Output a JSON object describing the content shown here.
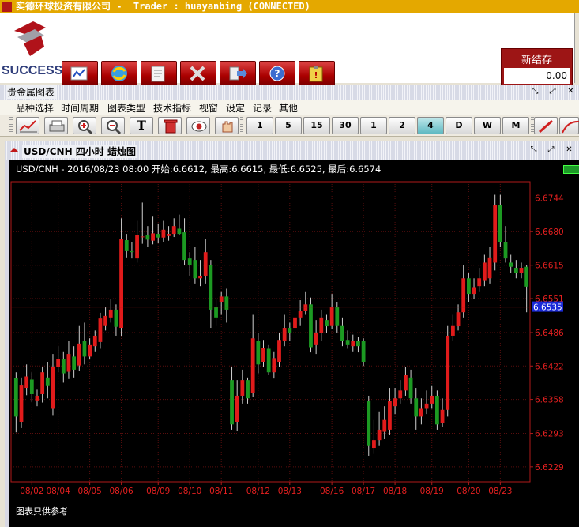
{
  "window": {
    "title": "实德环球投资有限公司 -  Trader : huayanbing (CONNECTED)"
  },
  "brand": {
    "logo_text": "SUCCESS"
  },
  "nav": {
    "buttons": [
      {
        "name": "chart-nav-button",
        "icon": "chart-icon"
      },
      {
        "name": "exchange-nav-button",
        "icon": "exchange-icon"
      },
      {
        "name": "orders-nav-button",
        "icon": "notepad-icon"
      },
      {
        "name": "tools-nav-button",
        "icon": "tools-icon"
      },
      {
        "name": "export-nav-button",
        "icon": "export-icon"
      },
      {
        "name": "help-nav-button",
        "icon": "help-icon"
      },
      {
        "name": "clipboard-nav-button",
        "icon": "clipboard-icon"
      }
    ]
  },
  "balance": {
    "label": "新结存",
    "value": "0.00"
  },
  "panel": {
    "title": "贵金属图表"
  },
  "menu": {
    "items": [
      "品种选择",
      "时间周期",
      "图表类型",
      "技术指标",
      "视窗",
      "设定",
      "记录",
      "其他"
    ]
  },
  "toolbar": {
    "period_buttons": [
      "1",
      "5",
      "15",
      "30",
      "1",
      "2",
      "4",
      "D",
      "W",
      "M"
    ]
  },
  "chart_window": {
    "title": "USD/CNH 四小时 蜡烛图",
    "info": "USD/CNH - 2016/08/23 08:00 开始:6.6612, 最高:6.6615, 最低:6.6525, 最后:6.6574",
    "footer": "图表只供参考",
    "current_price_label": "6.6535"
  },
  "chart_data": {
    "type": "candlestick",
    "symbol": "USD/CNH",
    "timeframe": "四小时",
    "y_ticks": [
      "6.6744",
      "6.6680",
      "6.6615",
      "6.6551",
      "6.6486",
      "6.6422",
      "6.6358",
      "6.6293",
      "6.6229"
    ],
    "x_ticks": [
      "08/02",
      "08/04",
      "08/05",
      "08/06",
      "08/09",
      "08/10",
      "08/11",
      "08/12",
      "08/13",
      "08/16",
      "08/17",
      "08/18",
      "08/19",
      "08/20",
      "08/23"
    ],
    "ylim": [
      6.62,
      6.6775
    ],
    "current_price": 6.6535,
    "colors": {
      "up": "#e11b1b",
      "down": "#1c9a22",
      "wick": "#d0d0d0",
      "grid": "#5a0e0e",
      "frame": "#b01a1a"
    },
    "candles": [
      [
        6.6399,
        6.6325,
        6.641,
        6.6295
      ],
      [
        6.6315,
        6.6386,
        6.64,
        6.6303
      ],
      [
        6.638,
        6.6402,
        6.6425,
        6.6366
      ],
      [
        6.6396,
        6.6368,
        6.641,
        6.6353
      ],
      [
        6.6356,
        6.6365,
        6.6378,
        6.6345
      ],
      [
        6.6368,
        6.641,
        6.642,
        6.6352
      ],
      [
        6.64,
        6.6385,
        6.643,
        6.636
      ],
      [
        6.634,
        6.642,
        6.6445,
        6.6328
      ],
      [
        6.642,
        6.6435,
        6.646,
        6.641
      ],
      [
        6.6435,
        6.6408,
        6.645,
        6.639
      ],
      [
        6.6411,
        6.6445,
        6.647,
        6.6397
      ],
      [
        6.644,
        6.6415,
        6.646,
        6.64
      ],
      [
        6.6423,
        6.6465,
        6.65,
        6.6412
      ],
      [
        6.647,
        6.644,
        6.6505,
        6.6425
      ],
      [
        6.644,
        6.6462,
        6.6475,
        6.6435
      ],
      [
        6.646,
        6.648,
        6.649,
        6.645
      ],
      [
        6.6468,
        6.6513,
        6.6524,
        6.6455
      ],
      [
        6.65,
        6.6518,
        6.6535,
        6.649
      ],
      [
        6.6515,
        6.653,
        6.655,
        6.6505
      ],
      [
        6.653,
        6.6497,
        6.654,
        6.648
      ],
      [
        6.6495,
        6.6665,
        6.6705,
        6.648
      ],
      [
        6.6663,
        6.6642,
        6.6675,
        6.663
      ],
      [
        6.6642,
        6.664,
        6.666,
        6.6628
      ],
      [
        6.6628,
        6.6673,
        6.67,
        6.662
      ],
      [
        6.667,
        6.667,
        6.6735,
        6.6656
      ],
      [
        6.6672,
        6.6664,
        6.669,
        6.665
      ],
      [
        6.6662,
        6.6676,
        6.6708,
        6.6655
      ],
      [
        6.6675,
        6.6668,
        6.6695,
        6.6658
      ],
      [
        6.6668,
        6.6683,
        6.67,
        6.666
      ],
      [
        6.6671,
        6.6675,
        6.669,
        6.6662
      ],
      [
        6.6675,
        6.669,
        6.6705,
        6.6669
      ],
      [
        6.6685,
        6.6675,
        6.6712,
        6.6672
      ],
      [
        6.6678,
        6.6625,
        6.6705,
        6.6615
      ],
      [
        6.6628,
        6.6615,
        6.664,
        6.6595
      ],
      [
        6.6625,
        6.659,
        6.665,
        6.658
      ],
      [
        6.659,
        6.6595,
        6.6625,
        6.6575
      ],
      [
        6.6595,
        6.664,
        6.6665,
        6.658
      ],
      [
        6.6615,
        6.653,
        6.6625,
        6.6495
      ],
      [
        6.6535,
        6.6515,
        6.655,
        6.65
      ],
      [
        6.6545,
        6.6555,
        6.6565,
        6.652
      ],
      [
        6.6555,
        6.653,
        6.657,
        6.6505
      ],
      [
        6.6395,
        6.631,
        6.642,
        6.63
      ],
      [
        6.6315,
        6.6365,
        6.6395,
        6.6298
      ],
      [
        6.6365,
        6.6395,
        6.6415,
        6.635
      ],
      [
        6.6395,
        6.636,
        6.64,
        6.635
      ],
      [
        6.637,
        6.6475,
        6.652,
        6.6362
      ],
      [
        6.647,
        6.6425,
        6.6485,
        6.6408
      ],
      [
        6.643,
        6.6457,
        6.6472,
        6.642
      ],
      [
        6.6455,
        6.641,
        6.6462,
        6.6405
      ],
      [
        6.641,
        6.6437,
        6.645,
        6.6398
      ],
      [
        6.643,
        6.6472,
        6.6485,
        6.642
      ],
      [
        6.647,
        6.6495,
        6.652,
        6.646
      ],
      [
        6.6495,
        6.6485,
        6.6505,
        6.647
      ],
      [
        6.6495,
        6.6515,
        6.6545,
        6.6482
      ],
      [
        6.6515,
        6.6528,
        6.6548,
        6.65
      ],
      [
        6.6527,
        6.654,
        6.6565,
        6.652
      ],
      [
        6.654,
        6.6458,
        6.6553,
        6.6448
      ],
      [
        6.6462,
        6.6485,
        6.651,
        6.6445
      ],
      [
        6.6485,
        6.6515,
        6.653,
        6.647
      ],
      [
        6.651,
        6.6498,
        6.652,
        6.6485
      ],
      [
        6.65,
        6.6535,
        6.656,
        6.6492
      ],
      [
        6.6535,
        6.65,
        6.6545,
        6.6485
      ],
      [
        6.65,
        6.647,
        6.6515,
        6.646
      ],
      [
        6.6472,
        6.6462,
        6.649,
        6.6455
      ],
      [
        6.646,
        6.647,
        6.6482,
        6.645
      ],
      [
        6.647,
        6.646,
        6.6478,
        6.6448
      ],
      [
        6.647,
        6.643,
        6.6475,
        6.6422
      ],
      [
        6.6355,
        6.627,
        6.6365,
        6.625
      ],
      [
        6.6265,
        6.628,
        6.632,
        6.6255
      ],
      [
        6.628,
        6.63,
        6.6335,
        6.627
      ],
      [
        6.6296,
        6.632,
        6.6345,
        6.6282
      ],
      [
        6.63,
        6.6355,
        6.638,
        6.629
      ],
      [
        6.6345,
        6.636,
        6.638,
        6.633
      ],
      [
        6.636,
        6.6375,
        6.6395,
        6.635
      ],
      [
        6.6375,
        6.6405,
        6.642,
        6.6365
      ],
      [
        6.64,
        6.636,
        6.6415,
        6.635
      ],
      [
        6.636,
        6.6325,
        6.638,
        6.63
      ],
      [
        6.6325,
        6.634,
        6.636,
        6.631
      ],
      [
        6.634,
        6.635,
        6.6375,
        6.633
      ],
      [
        6.635,
        6.6365,
        6.6385,
        6.634
      ],
      [
        6.6365,
        6.631,
        6.6375,
        6.63
      ],
      [
        6.6312,
        6.6338,
        6.636,
        6.6305
      ],
      [
        6.6338,
        6.648,
        6.65,
        6.6325
      ],
      [
        6.648,
        6.65,
        6.652,
        6.647
      ],
      [
        6.6498,
        6.6525,
        6.654,
        6.649
      ],
      [
        6.6525,
        6.659,
        6.6615,
        6.6515
      ],
      [
        6.659,
        6.656,
        6.66,
        6.6545
      ],
      [
        6.656,
        6.6573,
        6.659,
        6.655
      ],
      [
        6.6575,
        6.659,
        6.661,
        6.6565
      ],
      [
        6.6585,
        6.662,
        6.6635,
        6.6575
      ],
      [
        6.659,
        6.663,
        6.665,
        6.658
      ],
      [
        6.662,
        6.673,
        6.675,
        6.6605
      ],
      [
        6.673,
        6.666,
        6.675,
        6.665
      ],
      [
        6.666,
        6.6628,
        6.669,
        6.662
      ],
      [
        6.662,
        6.6612,
        6.6635,
        6.66
      ],
      [
        6.661,
        6.66,
        6.6625,
        6.659
      ],
      [
        6.66,
        6.661,
        6.662,
        6.659
      ],
      [
        6.6612,
        6.6574,
        6.6615,
        6.6525
      ]
    ]
  }
}
